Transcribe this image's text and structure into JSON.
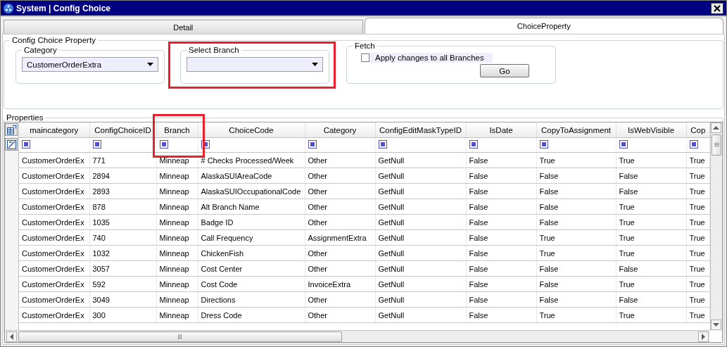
{
  "window": {
    "title": "System | Config Choice"
  },
  "tabs": [
    {
      "label": "Detail",
      "selected": false
    },
    {
      "label": "ChoiceProperty",
      "selected": true
    }
  ],
  "config_group": {
    "title": "Config Choice Property",
    "category": {
      "label": "Category",
      "value": "CustomerOrderExtra",
      "highlighted": false
    },
    "select_branch": {
      "label": "Select Branch",
      "highlighted": true
    },
    "fetch": {
      "label": "Fetch",
      "checkbox": {
        "label": "Apply changes to all Branches",
        "checked": false
      },
      "button": "Go"
    }
  },
  "properties": {
    "title": "Properties",
    "columns": [
      {
        "label": "maincategory",
        "highlighted": false
      },
      {
        "label": "ConfigChoiceID",
        "highlighted": false
      },
      {
        "label": "Branch",
        "highlighted": true
      },
      {
        "label": "ChoiceCode",
        "highlighted": false
      },
      {
        "label": "Category",
        "highlighted": false
      },
      {
        "label": "ConfigEditMaskTypeID",
        "highlighted": false
      },
      {
        "label": "IsDate",
        "highlighted": false
      },
      {
        "label": "CopyToAssignment",
        "highlighted": false
      },
      {
        "label": "IsWebVisible",
        "highlighted": false
      },
      {
        "label": "Cop",
        "highlighted": false
      }
    ],
    "rows": [
      [
        "CustomerOrderEx",
        "771",
        "Minneap",
        "# Checks Processed/Week",
        "Other",
        "GetNull",
        "False",
        "True",
        "True",
        "True"
      ],
      [
        "CustomerOrderEx",
        "2894",
        "Minneap",
        "AlaskaSUIAreaCode",
        "Other",
        "GetNull",
        "False",
        "False",
        "False",
        "True"
      ],
      [
        "CustomerOrderEx",
        "2893",
        "Minneap",
        "AlaskaSUIOccupationalCode",
        "Other",
        "GetNull",
        "False",
        "False",
        "False",
        "True"
      ],
      [
        "CustomerOrderEx",
        "878",
        "Minneap",
        "Alt Branch Name",
        "Other",
        "GetNull",
        "False",
        "False",
        "True",
        "True"
      ],
      [
        "CustomerOrderEx",
        "1035",
        "Minneap",
        "Badge ID",
        "Other",
        "GetNull",
        "False",
        "False",
        "True",
        "True"
      ],
      [
        "CustomerOrderEx",
        "740",
        "Minneap",
        "Call Frequency",
        "AssignmentExtra",
        "GetNull",
        "False",
        "True",
        "True",
        "True"
      ],
      [
        "CustomerOrderEx",
        "1032",
        "Minneap",
        "ChickenFish",
        "Other",
        "GetNull",
        "False",
        "True",
        "True",
        "True"
      ],
      [
        "CustomerOrderEx",
        "3057",
        "Minneap",
        "Cost Center",
        "Other",
        "GetNull",
        "False",
        "False",
        "False",
        "True"
      ],
      [
        "CustomerOrderEx",
        "592",
        "Minneap",
        "Cost Code",
        "InvoiceExtra",
        "GetNull",
        "False",
        "False",
        "True",
        "True"
      ],
      [
        "CustomerOrderEx",
        "3049",
        "Minneap",
        "Directions",
        "Other",
        "GetNull",
        "False",
        "False",
        "False",
        "True"
      ],
      [
        "CustomerOrderEx",
        "300",
        "Minneap",
        "Dress Code",
        "Other",
        "GetNull",
        "False",
        "True",
        "True",
        "True"
      ]
    ]
  }
}
